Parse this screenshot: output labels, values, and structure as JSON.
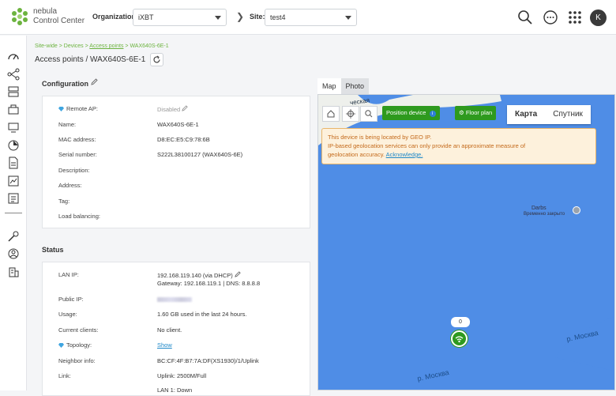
{
  "header": {
    "logo_line1": "nebula",
    "logo_line2": "Control Center",
    "org_label": "Organization:",
    "org_value": "iXBT",
    "site_label": "Site:",
    "site_value": "test4",
    "avatar_initial": "K",
    "icons": [
      "search-icon",
      "chat-icon",
      "apps-grid-icon"
    ]
  },
  "sidebar": {
    "icons": [
      "dashboard-icon",
      "topology-icon",
      "devices-icon",
      "security-icon",
      "monitor-icon",
      "report-icon",
      "document-icon",
      "chart-icon",
      "list-icon",
      "tools-icon",
      "support-icon",
      "building-icon"
    ]
  },
  "breadcrumb": {
    "site_wide": "Site-wide",
    "sep1": " > ",
    "devices": "Devices",
    "sep2": " > ",
    "access_points": "Access points",
    "sep3": " > ",
    "device": "WAX640S-6E-1"
  },
  "title": {
    "section": "Access points",
    "sep": " / ",
    "device": "WAX640S-6E-1"
  },
  "configuration": {
    "heading": "Configuration",
    "rows": [
      {
        "label": "Remote AP:",
        "value": "Disabled"
      },
      {
        "label": "Name:",
        "value": "WAX640S-6E-1"
      },
      {
        "label": "MAC address:",
        "value": "D8:EC:E5:C9:78:6B"
      },
      {
        "label": "Serial number:",
        "value": "S222L38100127 (WAX640S-6E)"
      },
      {
        "label": "Description:",
        "value": ""
      },
      {
        "label": "Address:",
        "value": ""
      },
      {
        "label": "Tag:",
        "value": ""
      },
      {
        "label": "Load balancing:",
        "value": ""
      }
    ]
  },
  "status": {
    "heading": "Status",
    "lan_ip_label": "LAN IP:",
    "lan_ip_value": "192.168.119.140  (via DHCP)",
    "lan_ip_detail": "Gateway: 192.168.119.1   |   DNS: 8.8.8.8",
    "public_ip_label": "Public IP:",
    "usage_label": "Usage:",
    "usage_value": "1.60 GB used in the last 24 hours.",
    "clients_label": "Current clients:",
    "clients_value": "No client.",
    "topology_label": "Topology:",
    "topology_value": "Show",
    "neighbor_label": "Neighbor info:",
    "neighbor_value": "BC:CF:4F:B7:7A:DF(XS1930)/1/Uplink",
    "link_label": "Link:",
    "link_value": "Uplink: 2500M/Full",
    "link_value2": "LAN 1: Down"
  },
  "map": {
    "tab_map": "Map",
    "tab_photo": "Photo",
    "position_btn": "Position device",
    "floor_btn": "Floor plan",
    "maptype_map": "Карта",
    "maptype_sat": "Спутник",
    "note_line1": "This device is being located by GEO IP.",
    "note_line2": "IP-based geolocation services can only provide an approximate measure of",
    "note_line3": "geolocation accuracy.",
    "note_link": "Acknowledge.",
    "poi_name": "Darbs",
    "poi_status": "Временно закрыто",
    "river1": "р. Москва",
    "river2": "р. Москва",
    "device_count": "0"
  }
}
